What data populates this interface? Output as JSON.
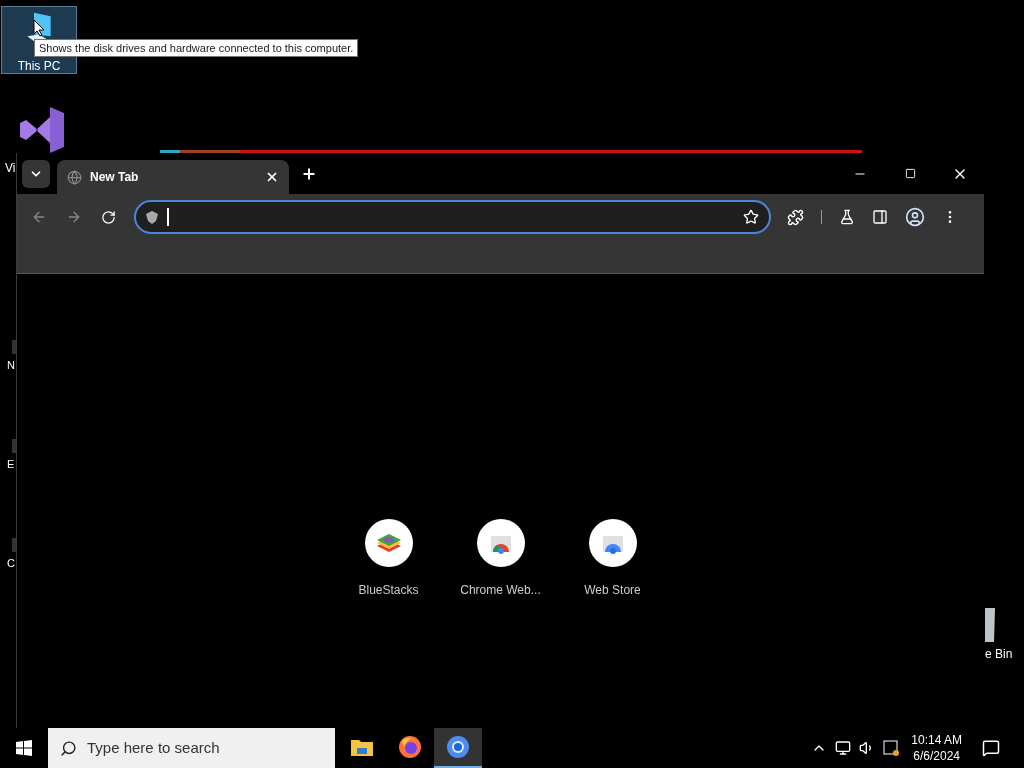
{
  "desktop": {
    "this_pc": {
      "label": "This PC",
      "selected": true
    },
    "tooltip": "Shows the disk drives and hardware connected to this computer.",
    "partial_icons": [
      {
        "kind": "vs",
        "label": "Vi"
      },
      {
        "kind": "plain",
        "label": "N"
      },
      {
        "kind": "plain",
        "label": "E"
      },
      {
        "kind": "plain",
        "label": "C"
      }
    ],
    "recycle_bin": {
      "label": "e Bin"
    }
  },
  "browser": {
    "tabs": [
      {
        "title": "New Tab",
        "selected": true
      }
    ],
    "address_bar": {
      "focused": true
    },
    "shortcuts": [
      {
        "kind": "bluestacks",
        "label": "BlueStacks"
      },
      {
        "kind": "chrome-store",
        "label": "Chrome Web..."
      },
      {
        "kind": "web-store",
        "label": "Web Store"
      }
    ]
  },
  "taskbar": {
    "search": {
      "placeholder": "Type here to search"
    },
    "apps": [
      {
        "kind": "explorer",
        "selected": false
      },
      {
        "kind": "firefox",
        "selected": false
      },
      {
        "kind": "chrome",
        "selected": true
      }
    ],
    "clock": {
      "time": "10:14 AM",
      "date": "6/6/2024"
    }
  }
}
